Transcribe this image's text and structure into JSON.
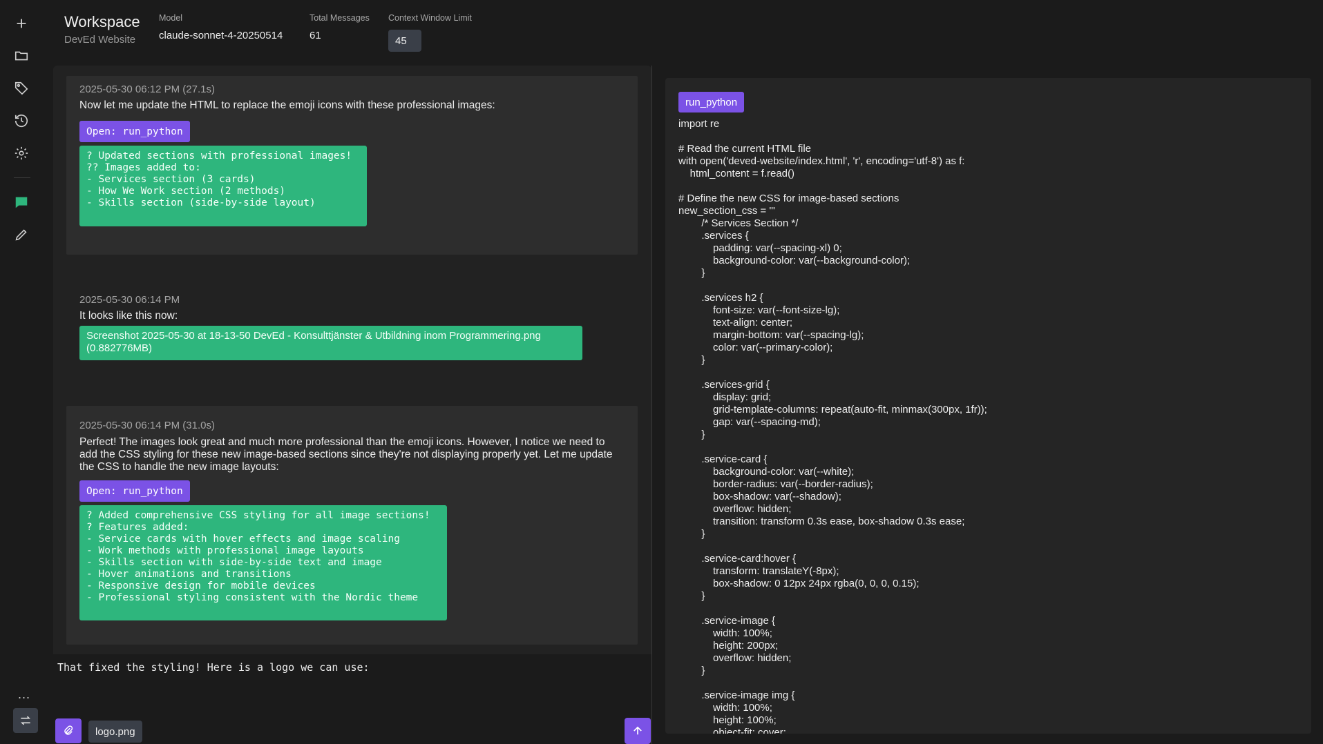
{
  "sidebar": {
    "icons": [
      "plus-icon",
      "folder-icon",
      "tag-icon",
      "history-icon",
      "gear-icon",
      "chat-icon",
      "pencil-icon"
    ],
    "more": "...",
    "swap": "swap-icon"
  },
  "header": {
    "title": "Workspace",
    "subtitle": "DevEd Website",
    "model_label": "Model",
    "model_value": "claude-sonnet-4-20250514",
    "messages_label": "Total Messages",
    "messages_value": "61",
    "context_label": "Context Window Limit",
    "context_value": "45"
  },
  "messages": [
    {
      "timestamp": "2025-05-30 06:12 PM (27.1s)",
      "text": "Now let me update the HTML to replace the emoji icons with these professional images:",
      "tool_label": "Open: run_python",
      "result": "? Updated sections with professional images!\n?? Images added to:\n- Services section (3 cards)\n- How We Work section (2 methods)\n- Skills section (side-by-side layout)"
    },
    {
      "timestamp": "2025-05-30 06:14 PM",
      "text": "It looks like this now:",
      "attachment": "Screenshot 2025-05-30 at 18-13-50 DevEd - Konsulttjänster & Utbildning inom Programmering.png (0.882776MB)"
    },
    {
      "timestamp": "2025-05-30 06:14 PM (31.0s)",
      "text": "Perfect! The images look great and much more professional than the emoji icons. However, I notice we need to add the CSS styling for these new image-based sections since they're not displaying properly yet. Let me update the CSS to handle the new image layouts:",
      "tool_label": "Open: run_python",
      "result": "? Added comprehensive CSS styling for all image sections!\n? Features added:\n- Service cards with hover effects and image scaling\n- Work methods with professional image layouts\n- Skills section with side-by-side text and image\n- Hover animations and transitions\n- Responsive design for mobile devices\n- Professional styling consistent with the Nordic theme"
    }
  ],
  "composer": {
    "text": "That fixed the styling! Here is a logo we can use:",
    "file": "logo.png"
  },
  "code_panel": {
    "badge": "run_python",
    "code": "import re\n\n# Read the current HTML file\nwith open('deved-website/index.html', 'r', encoding='utf-8') as f:\n    html_content = f.read()\n\n# Define the new CSS for image-based sections\nnew_section_css = '''\n        /* Services Section */\n        .services {\n            padding: var(--spacing-xl) 0;\n            background-color: var(--background-color);\n        }\n\n        .services h2 {\n            font-size: var(--font-size-lg);\n            text-align: center;\n            margin-bottom: var(--spacing-lg);\n            color: var(--primary-color);\n        }\n\n        .services-grid {\n            display: grid;\n            grid-template-columns: repeat(auto-fit, minmax(300px, 1fr));\n            gap: var(--spacing-md);\n        }\n\n        .service-card {\n            background-color: var(--white);\n            border-radius: var(--border-radius);\n            box-shadow: var(--shadow);\n            overflow: hidden;\n            transition: transform 0.3s ease, box-shadow 0.3s ease;\n        }\n\n        .service-card:hover {\n            transform: translateY(-8px);\n            box-shadow: 0 12px 24px rgba(0, 0, 0, 0.15);\n        }\n\n        .service-image {\n            width: 100%;\n            height: 200px;\n            overflow: hidden;\n        }\n\n        .service-image img {\n            width: 100%;\n            height: 100%;\n            object-fit: cover;"
  }
}
